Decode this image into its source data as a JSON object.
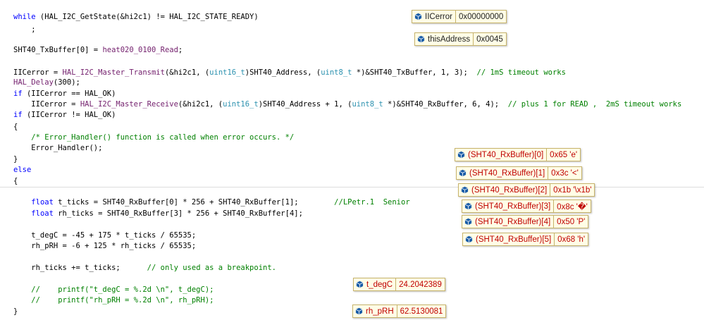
{
  "code": {
    "l01": {
      "a": "while",
      "b": " (HAL_I2C_GetState(&hi2c1) != HAL_I2C_STATE_READY)"
    },
    "l02": {
      "a": "    ;"
    },
    "l03": {
      "a": "SHT40_TxBuffer[0] = ",
      "b": "heat020_0100_Read",
      "c": ";"
    },
    "l04": {
      "a": "IICerror = ",
      "b": "HAL_I2C_Master_Transmit",
      "c": "(&hi2c1, (",
      "d": "uint16_t",
      "e": ")SHT40_Address, (",
      "f": "uint8_t",
      "g": " *)&SHT40_TxBuffer, 1, 3);  ",
      "h": "// 1mS timeout works"
    },
    "l05": {
      "a": "HAL_Delay",
      "b": "(300);"
    },
    "l06": {
      "a": "if",
      "b": " (IICerror == HAL_OK)"
    },
    "l07": {
      "a": "    IICerror = ",
      "b": "HAL_I2C_Master_Receive",
      "c": "(&hi2c1, (",
      "d": "uint16_t",
      "e": ")SHT40_Address + 1, (",
      "f": "uint8_t",
      "g": " *)&SHT40_RxBuffer, 6, 4);  ",
      "h": "// plus 1 for READ ,  2mS timeout works"
    },
    "l08": {
      "a": "if",
      "b": " (IICerror != HAL_OK)"
    },
    "l09": {
      "a": "{"
    },
    "l10": {
      "a": "    /* Error_Handler() function is called when error occurs. */"
    },
    "l11": {
      "a": "    Error_Handler();"
    },
    "l12": {
      "a": "}"
    },
    "l13": {
      "a": "else"
    },
    "l14": {
      "a": "{"
    },
    "l15": {
      "a": "    ",
      "b": "float",
      "c": " t_ticks = SHT40_RxBuffer[0] * 256 + SHT40_RxBuffer[1];        ",
      "d": "//LPetr.1  Senior"
    },
    "l16": {
      "a": "    ",
      "b": "float",
      "c": " rh_ticks = SHT40_RxBuffer[3] * 256 + SHT40_RxBuffer[4];"
    },
    "l17": {
      "a": "    t_degC = -45 + 175 * t_ticks / 65535;"
    },
    "l18": {
      "a": "    rh_pRH = -6 + 125 * rh_ticks / 65535;"
    },
    "l19": {
      "a": "    rh_ticks += t_ticks;      ",
      "b": "// only used as a breakpoint."
    },
    "l20": {
      "a": "    //    printf(\"t_degC = %.2d \\n\", t_degC);"
    },
    "l21": {
      "a": "    //    printf(\"rh_pRH = %.2d \\n\", rh_pRH);"
    },
    "l22": {
      "a": "}"
    }
  },
  "tooltips": {
    "iicerror": {
      "name": "IICerror",
      "value": "0x00000000"
    },
    "thisaddress": {
      "name": "thisAddress",
      "value": "0x0045"
    },
    "rx0": {
      "name": "(SHT40_RxBuffer)[0]",
      "value": "0x65 'e'"
    },
    "rx1": {
      "name": "(SHT40_RxBuffer)[1]",
      "value": "0x3c '<'"
    },
    "rx2": {
      "name": "(SHT40_RxBuffer)[2]",
      "value": "0x1b '\\x1b'"
    },
    "rx3": {
      "name": "(SHT40_RxBuffer)[3]",
      "value": "0x8c '�'"
    },
    "rx4": {
      "name": "(SHT40_RxBuffer)[4]",
      "value": "0x50 'P'"
    },
    "rx5": {
      "name": "(SHT40_RxBuffer)[5]",
      "value": "0x68 'h'"
    },
    "tdegc": {
      "name": "t_degC",
      "value": "24.2042389"
    },
    "rhprh": {
      "name": "rh_pRH",
      "value": "62.5130081"
    }
  },
  "icon": "variable-cube-icon",
  "colors": {
    "keyword": "#0000ff",
    "type": "#2b91af",
    "function": "#74216e",
    "comment": "#008000",
    "tooltip_bg": "#fffde6",
    "tooltip_border": "#c7b36b",
    "changed_value": "#c00000",
    "icon": "#1b5ea8"
  }
}
